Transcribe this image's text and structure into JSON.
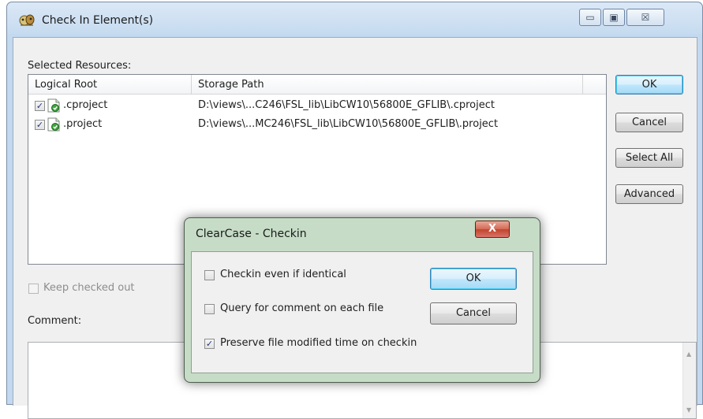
{
  "main_window": {
    "title": "Check In Element(s)",
    "title_icon": "clearcase-checkin-icon",
    "caption_buttons": {
      "minimize_glyph": "▭",
      "maximize_glyph": "▣",
      "close_glyph": "☒"
    }
  },
  "selected_resources": {
    "label": "Selected Resources:",
    "columns": [
      "Logical Root",
      "Storage Path"
    ],
    "rows": [
      {
        "checked": true,
        "icon": "project-file-icon",
        "logical_root": ".cproject",
        "storage_path": "D:\\views\\...C246\\FSL_lib\\LibCW10\\56800E_GFLIB\\.cproject"
      },
      {
        "checked": true,
        "icon": "project-file-icon",
        "logical_root": ".project",
        "storage_path": "D:\\views\\...MC246\\FSL_lib\\LibCW10\\56800E_GFLIB\\.project"
      }
    ]
  },
  "side_buttons": {
    "ok": "OK",
    "cancel": "Cancel",
    "select_all": "Select All",
    "advanced": "Advanced"
  },
  "keep_checked_out": {
    "label": "Keep checked out",
    "checked": false,
    "enabled": false
  },
  "comment": {
    "label": "Comment:",
    "value": ""
  },
  "checkin_dialog": {
    "title": "ClearCase - Checkin",
    "close_glyph": "X",
    "options": [
      {
        "label": "Checkin even if identical",
        "checked": false
      },
      {
        "label": "Query for comment on each file",
        "checked": false
      },
      {
        "label": "Preserve file modified time on checkin",
        "checked": true
      }
    ],
    "ok": "OK",
    "cancel": "Cancel"
  },
  "colors": {
    "title_bar": "#c6dbf0",
    "dialog_frame": "#c6dcc7",
    "default_button_border": "#3c7fb1",
    "close_button": "#c0432c"
  }
}
